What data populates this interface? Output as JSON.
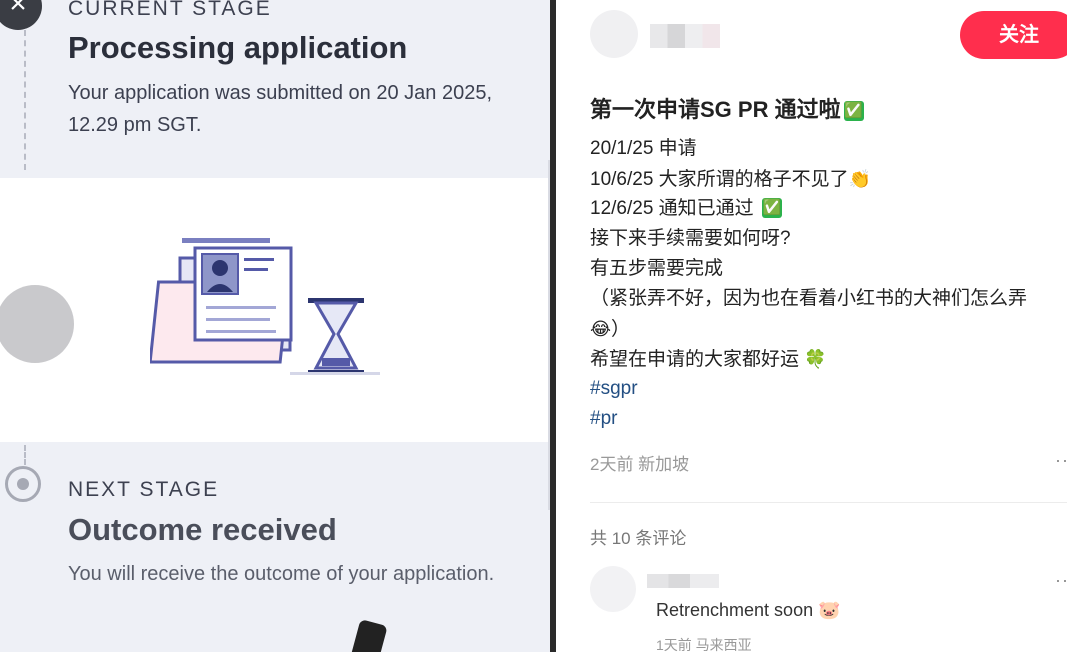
{
  "left_panel": {
    "current_stage_label": "CURRENT STAGE",
    "current_stage_title": "Processing application",
    "current_stage_desc": "Your application was submitted on 20 Jan 2025, 12.29 pm SGT.",
    "next_stage_label": "NEXT STAGE",
    "next_stage_title": "Outcome received",
    "next_stage_desc": "You will receive the outcome of your application.",
    "close_icon": "close-icon",
    "illustration": "document-hourglass-illustration"
  },
  "post": {
    "follow_label": "关注",
    "title": "第一次申请SG PR 通过啦",
    "title_emoji": "✅",
    "lines": [
      {
        "text": "20/1/25 申请",
        "emoji": ""
      },
      {
        "text": "10/6/25 大家所谓的格子不见了",
        "emoji": "👏"
      },
      {
        "text": "12/6/25 通知已通过",
        "emoji": "✅"
      },
      {
        "text": "接下来手续需要如何呀?",
        "emoji": ""
      },
      {
        "text": "有五步需要完成",
        "emoji": ""
      },
      {
        "text": "（紧张弄不好，因为也在看着小红书的大神们怎么弄",
        "emoji": ""
      },
      {
        "text": "）",
        "emoji": "😂"
      },
      {
        "text": "希望在申请的大家都好运",
        "emoji": "🍀"
      }
    ],
    "tags": [
      "#sgpr",
      "#pr"
    ],
    "meta": "2天前 新加坡",
    "more_glyph": "··",
    "comments_count": "共 10 条评论"
  },
  "comment": {
    "text": "Retrenchment soon",
    "emoji": "🐷",
    "meta": "1天前 马来西亚",
    "more_glyph": "··"
  },
  "colors": {
    "follow_button": "#ff2e4d",
    "tag": "#234f83",
    "check": "#2bb24c"
  }
}
